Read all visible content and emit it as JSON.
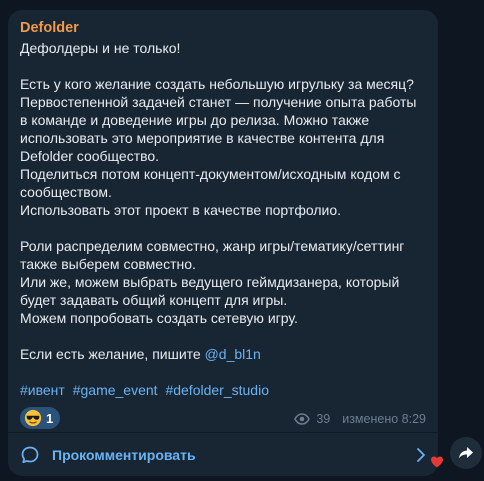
{
  "post": {
    "sender": "Defolder",
    "body": "Дефолдеры и не только!\n\nЕсть у кого желание создать небольшую игрульку за месяц?\nПервостепенной задачей станет — получение опыта работы в команде и доведение игры до релиза. Можно также использовать это мероприятие в качестве контента для Defolder сообщество.\nПоделиться потом концепт-документом/исходным кодом с сообществом.\nИспользовать этот проект в качестве портфолио.\n\nРоли распределим совместно, жанр игры/тематику/сеттинг также выберем совместно.\nИли же, можем выбрать ведущего геймдизанера, который будет задавать общий концепт для игры.\nМожем попробовать создать сетевую игру.\n\n",
    "contact_prefix": "Если есть желание, пишите ",
    "contact_mention": "@d_bl1n",
    "hashtags": [
      "#ивент",
      "#game_event",
      "#defolder_studio"
    ],
    "reaction": {
      "emoji": "sunglasses-face",
      "count": "1"
    },
    "views": "39",
    "edited": "изменено 8:29"
  },
  "comments": {
    "label": "Прокомментировать"
  },
  "colors": {
    "background": "#0e1621",
    "bubble": "#182533",
    "sender": "#f09a4a",
    "link": "#6ab3f3",
    "meta": "#6d7f8f"
  }
}
